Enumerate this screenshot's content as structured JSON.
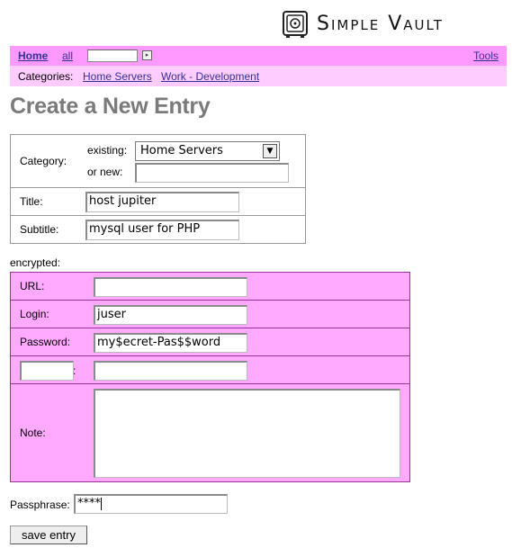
{
  "app": {
    "name": "Simple Vault"
  },
  "nav": {
    "home": "Home",
    "all": "all",
    "search_value": "",
    "tools": "Tools"
  },
  "categories_bar": {
    "label": "Categories:",
    "items": [
      "Home Servers",
      "Work - Development"
    ]
  },
  "page": {
    "title": "Create a New Entry"
  },
  "form": {
    "category_label": "Category:",
    "existing_label": "existing:",
    "existing_value": "Home Servers",
    "new_label": "or new:",
    "new_value": "",
    "title_label": "Title:",
    "title_value": "host jupiter",
    "subtitle_label": "Subtitle:",
    "subtitle_value": "mysql user for PHP",
    "encrypted_label": "encrypted:",
    "url_label": "URL:",
    "url_value": "",
    "login_label": "Login:",
    "login_value": "juser",
    "password_label": "Password:",
    "password_value": "my$ecret-Pas$$word",
    "custom_key_value": "",
    "custom_sep": ":",
    "custom_value": "",
    "note_label": "Note:",
    "note_value": "",
    "passphrase_label": "Passphrase:",
    "passphrase_value": "****",
    "save_label": "save entry"
  },
  "colors": {
    "nav_bg": "#ff99ff",
    "cat_bg": "#ffccff",
    "encrypted_bg": "#ffaaff",
    "link": "#333399"
  }
}
